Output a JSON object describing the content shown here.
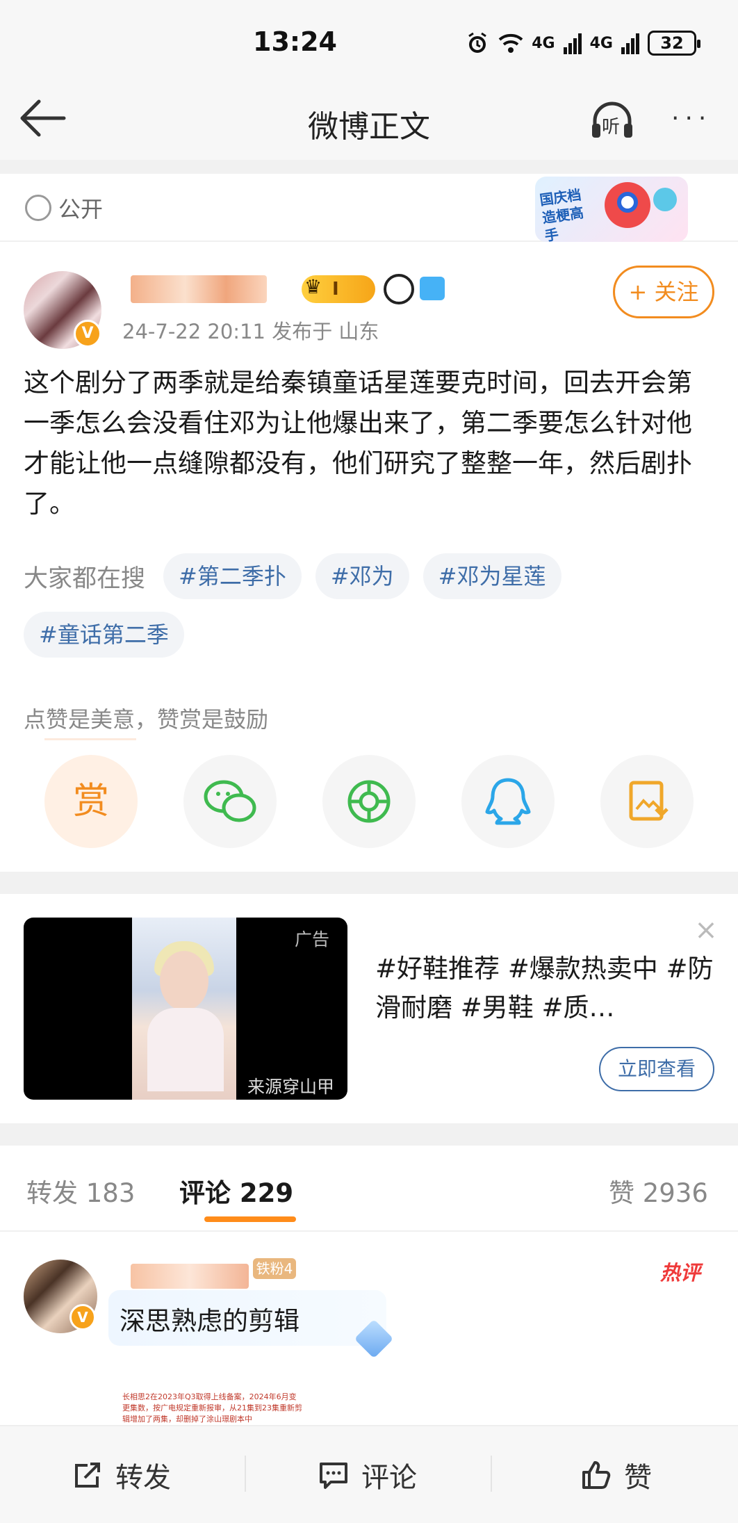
{
  "status_bar": {
    "time": "13:24",
    "signal_1": "4G",
    "signal_2": "4G",
    "battery": "32",
    "icons": [
      "alarm-icon",
      "wifi-icon",
      "signal-icon",
      "battery-icon"
    ]
  },
  "nav": {
    "title": "微博正文",
    "back_icon": "back-arrow-icon",
    "listen_label": "听",
    "more_label": "···"
  },
  "visibility": {
    "label": "公开",
    "promo_text": "国庆档 造梗高手"
  },
  "post": {
    "meta": "24-7-22 20:11   发布于 山东",
    "vip_level": "I",
    "follow_label": "+ 关注",
    "body": "这个剧分了两季就是给秦镇童话星莲要克时间，回去开会第一季怎么会没看住邓为让他爆出来了，第二季要怎么针对他才能让他一点缝隙都没有，他们研究了整整一年，然后剧扑了。",
    "search_label": "大家都在搜",
    "tags": [
      "#第二季扑",
      "#邓为",
      "#邓为星莲",
      "#童话第二季"
    ],
    "like_hint": "点赞是美意，赞赏是鼓励",
    "share_buttons": [
      {
        "name": "reward",
        "glyph": "赏",
        "color": "#f28c1f"
      },
      {
        "name": "wechat",
        "glyph": "💬",
        "color": "#3fba4f"
      },
      {
        "name": "moments",
        "glyph": "◎",
        "color": "#3fba4f"
      },
      {
        "name": "qq",
        "glyph": "🐧",
        "color": "#2ba6e8"
      },
      {
        "name": "save-image",
        "glyph": "⬇",
        "color": "#f0a72a"
      }
    ]
  },
  "ad": {
    "label": "广告",
    "source": "来源穿山甲",
    "text": "#好鞋推荐 #爆款热卖中 #防滑耐磨 #男鞋 #质…",
    "button": "立即查看",
    "close": "×"
  },
  "tabs": {
    "repost": "转发 183",
    "comment": "评论 229",
    "like": "赞 2936"
  },
  "comment": {
    "fan_badge": "铁粉4",
    "hot_label": "热评",
    "text": "深思熟虑的剪辑",
    "image_text": "长相思2在2023年Q3取得上线备案，2024年6月变更集数，按广电规定重新报审，从21集到23集重新剪辑增加了两集，却删掉了涂山璟剧本中"
  },
  "bottom_bar": {
    "repost": "转发",
    "comment": "评论",
    "like": "赞"
  }
}
